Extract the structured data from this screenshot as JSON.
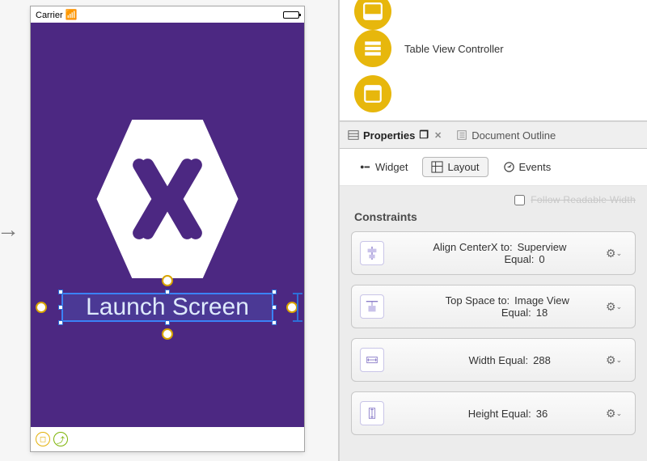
{
  "statusbar": {
    "carrier": "Carrier"
  },
  "launch_label": "Launch Screen",
  "library": {
    "items": [
      {
        "label": "Table View Controller"
      }
    ]
  },
  "panel_tabs": {
    "properties": "Properties",
    "outline": "Document Outline"
  },
  "mode_tabs": {
    "widget": "Widget",
    "layout": "Layout",
    "events": "Events"
  },
  "truncated_checkbox_label": "Follow Readable Width",
  "constraints_header": "Constraints",
  "constraints": [
    {
      "l1k": "Align CenterX to:",
      "l1v": "Superview",
      "l2k": "Equal:",
      "l2v": "0"
    },
    {
      "l1k": "Top Space to:",
      "l1v": "Image View",
      "l2k": "Equal:",
      "l2v": "18"
    },
    {
      "l1k": "Width Equal:",
      "l1v": "288",
      "l2k": "",
      "l2v": ""
    },
    {
      "l1k": "Height Equal:",
      "l1v": "36",
      "l2k": "",
      "l2v": ""
    }
  ]
}
